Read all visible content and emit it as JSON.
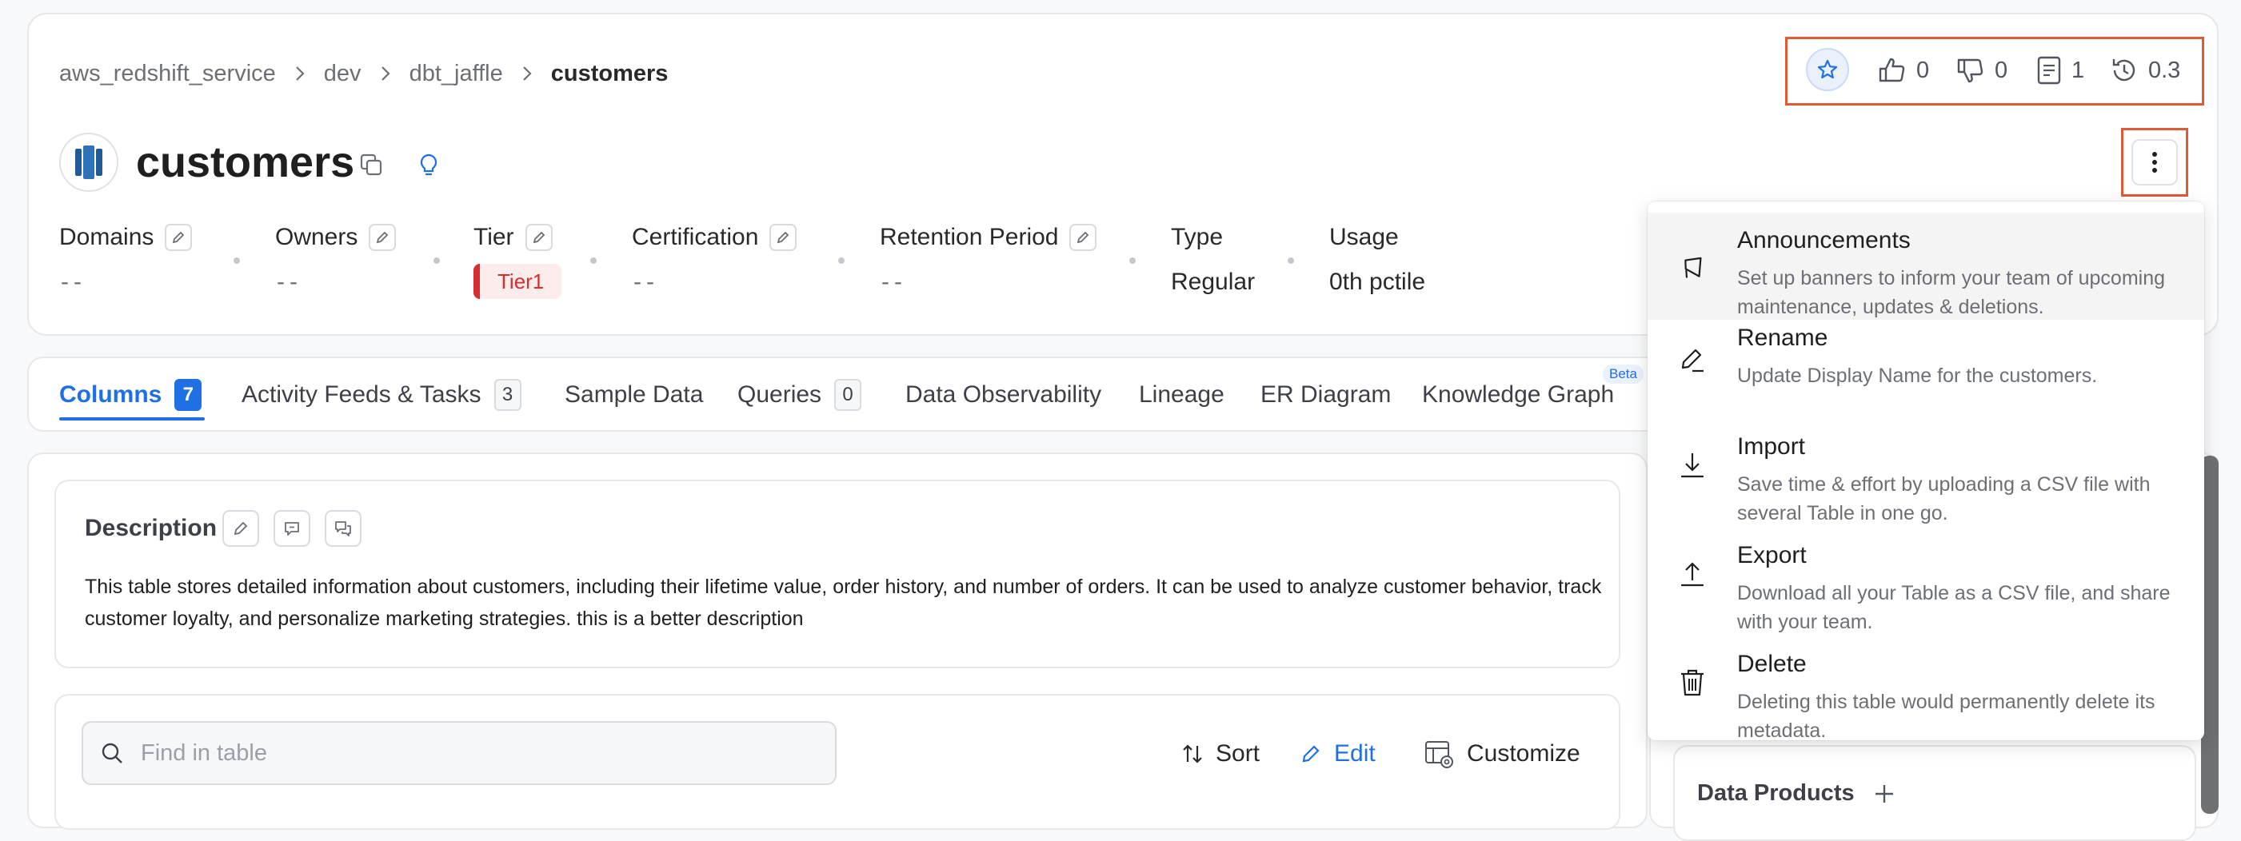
{
  "breadcrumb": {
    "items": [
      "aws_redshift_service",
      "dev",
      "dbt_jaffle"
    ],
    "current": "customers"
  },
  "entity": {
    "name": "customers"
  },
  "header_actions": {
    "votes_up": "0",
    "votes_down": "0",
    "conversations": "1",
    "version": "0.3"
  },
  "properties": {
    "domains": {
      "label": "Domains",
      "value": "--"
    },
    "owners": {
      "label": "Owners",
      "value": "--"
    },
    "tier": {
      "label": "Tier",
      "value": "Tier1"
    },
    "certification": {
      "label": "Certification",
      "value": "--"
    },
    "retention": {
      "label": "Retention Period",
      "value": "--"
    },
    "type": {
      "label": "Type",
      "value": "Regular"
    },
    "usage": {
      "label": "Usage",
      "value": "0th pctile"
    }
  },
  "tabs": [
    {
      "label": "Columns",
      "count": "7"
    },
    {
      "label": "Activity Feeds & Tasks",
      "count": "3"
    },
    {
      "label": "Sample Data"
    },
    {
      "label": "Queries",
      "count": "0"
    },
    {
      "label": "Data Observability"
    },
    {
      "label": "Lineage"
    },
    {
      "label": "ER Diagram"
    },
    {
      "label": "Knowledge Graph",
      "badge": "Beta"
    }
  ],
  "description": {
    "title": "Description",
    "text": "This table stores detailed information about customers, including their lifetime value, order history, and number of orders. It can be used to analyze customer behavior, track customer loyalty, and personalize marketing strategies. this is a better description"
  },
  "table_toolbar": {
    "search_placeholder": "Find in table",
    "sort_label": "Sort",
    "edit_label": "Edit",
    "customize_label": "Customize"
  },
  "side_panel": {
    "data_products_label": "Data Products"
  },
  "menu": [
    {
      "title": "Announcements",
      "desc": "Set up banners to inform your team of upcoming maintenance, updates & deletions.",
      "icon": "megaphone-icon"
    },
    {
      "title": "Rename",
      "desc": "Update Display Name for the customers.",
      "icon": "pencil-icon"
    },
    {
      "title": "Import",
      "desc": "Save time & effort by uploading a CSV file with several Table in one go.",
      "icon": "import-icon"
    },
    {
      "title": "Export",
      "desc": "Download all your Table as a CSV file, and share with your team.",
      "icon": "export-icon"
    },
    {
      "title": "Delete",
      "desc": "Deleting this table would permanently delete its metadata.",
      "icon": "trash-icon"
    }
  ],
  "colors": {
    "accent": "#1f6fe5",
    "highlight_border": "#e05a36",
    "tier_red": "#d42f2f"
  }
}
